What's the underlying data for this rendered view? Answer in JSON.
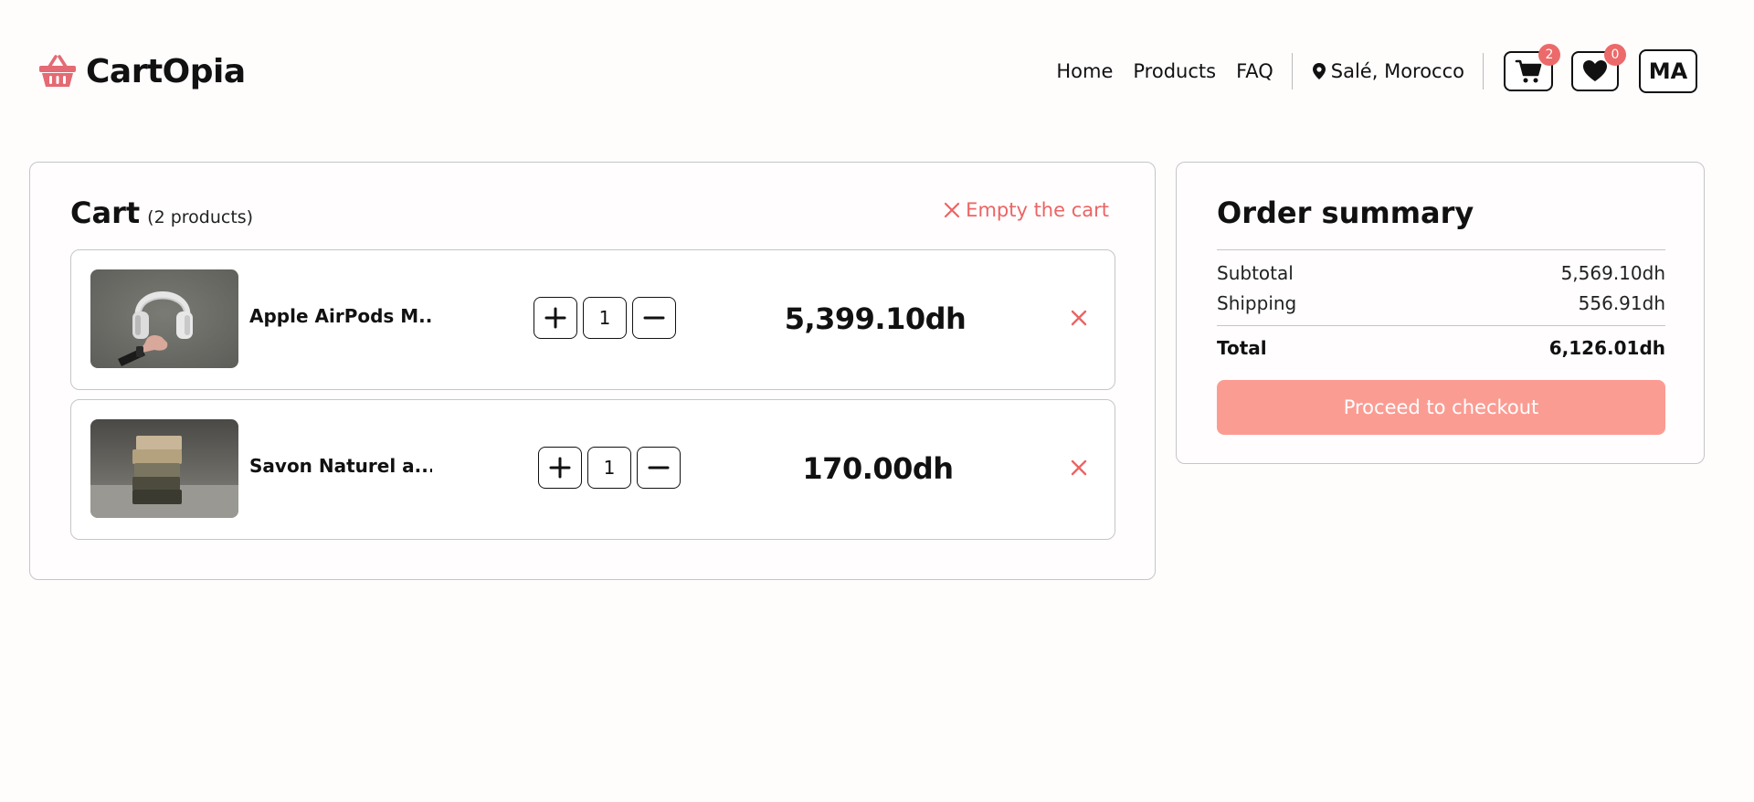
{
  "brand": {
    "name": "CartOpia",
    "logo_icon": "basket-icon",
    "accent_color": "#ec6464"
  },
  "nav": {
    "links": [
      "Home",
      "Products",
      "FAQ"
    ],
    "location": "Salé, Morocco",
    "cart_count": "2",
    "wishlist_count": "0",
    "profile_initials": "MA"
  },
  "cart": {
    "title": "Cart",
    "count_label": "(2 products)",
    "empty_label": "Empty the cart",
    "items": [
      {
        "name": "Apple AirPods M...",
        "quantity": "1",
        "price": "5,399.10dh",
        "image": "headphones-photo"
      },
      {
        "name": "Savon Naturel a...",
        "quantity": "1",
        "price": "170.00dh",
        "image": "soap-stack-photo"
      }
    ]
  },
  "summary": {
    "title": "Order summary",
    "subtotal_label": "Subtotal",
    "subtotal_value": "5,569.10dh",
    "shipping_label": "Shipping",
    "shipping_value": "556.91dh",
    "total_label": "Total",
    "total_value": "6,126.01dh",
    "checkout_label": "Proceed to checkout",
    "checkout_color": "#fb9c93"
  }
}
